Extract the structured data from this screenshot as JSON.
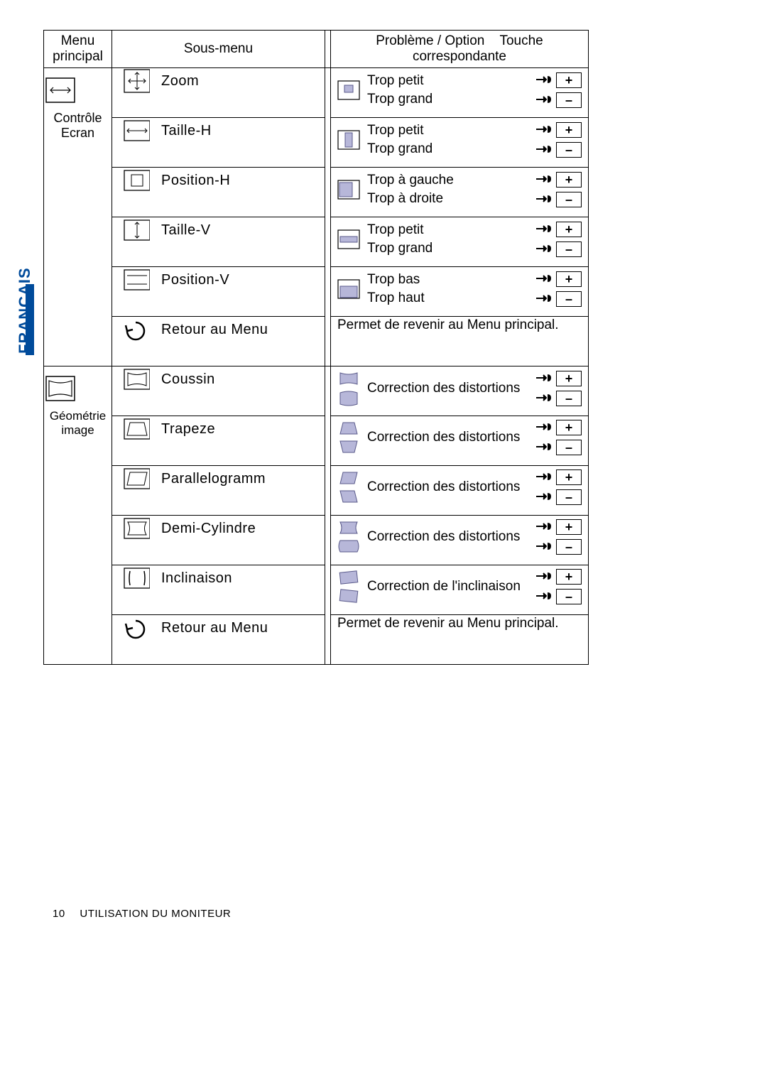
{
  "language_tab": "FRANCAIS",
  "headers": {
    "main": "Menu principal",
    "sub": "Sous-menu",
    "problem": "Problème / Option",
    "key": "Touche correspondante"
  },
  "section1": {
    "title": "Contrôle Ecran",
    "rows": [
      {
        "label": "Zoom",
        "p1": "Trop petit",
        "p2": "Trop grand"
      },
      {
        "label": "Taille-H",
        "p1": "Trop petit",
        "p2": "Trop grand"
      },
      {
        "label": "Position-H",
        "p1": "Trop à gauche",
        "p2": "Trop à droite"
      },
      {
        "label": "Taille-V",
        "p1": "Trop petit",
        "p2": "Trop grand"
      },
      {
        "label": "Position-V",
        "p1": "Trop bas",
        "p2": "Trop haut"
      },
      {
        "label": "Retour au Menu",
        "desc": "Permet de revenir au Menu principal."
      }
    ]
  },
  "section2": {
    "title": "Géométrie image",
    "rows": [
      {
        "label": "Coussin",
        "desc": "Correction des distortions"
      },
      {
        "label": "Trapeze",
        "desc": "Correction des distortions"
      },
      {
        "label": "Parallelogramm",
        "desc": "Correction des distortions"
      },
      {
        "label": "Demi-Cylindre",
        "desc": "Correction des distortions"
      },
      {
        "label": "Inclinaison",
        "desc": "Correction de l'inclinaison"
      },
      {
        "label": "Retour au Menu",
        "desc": "Permet de revenir au Menu principal."
      }
    ]
  },
  "keys": {
    "plus": "+",
    "minus": "–"
  },
  "footer": {
    "page": "10",
    "title": "UTILISATION DU MONITEUR"
  }
}
